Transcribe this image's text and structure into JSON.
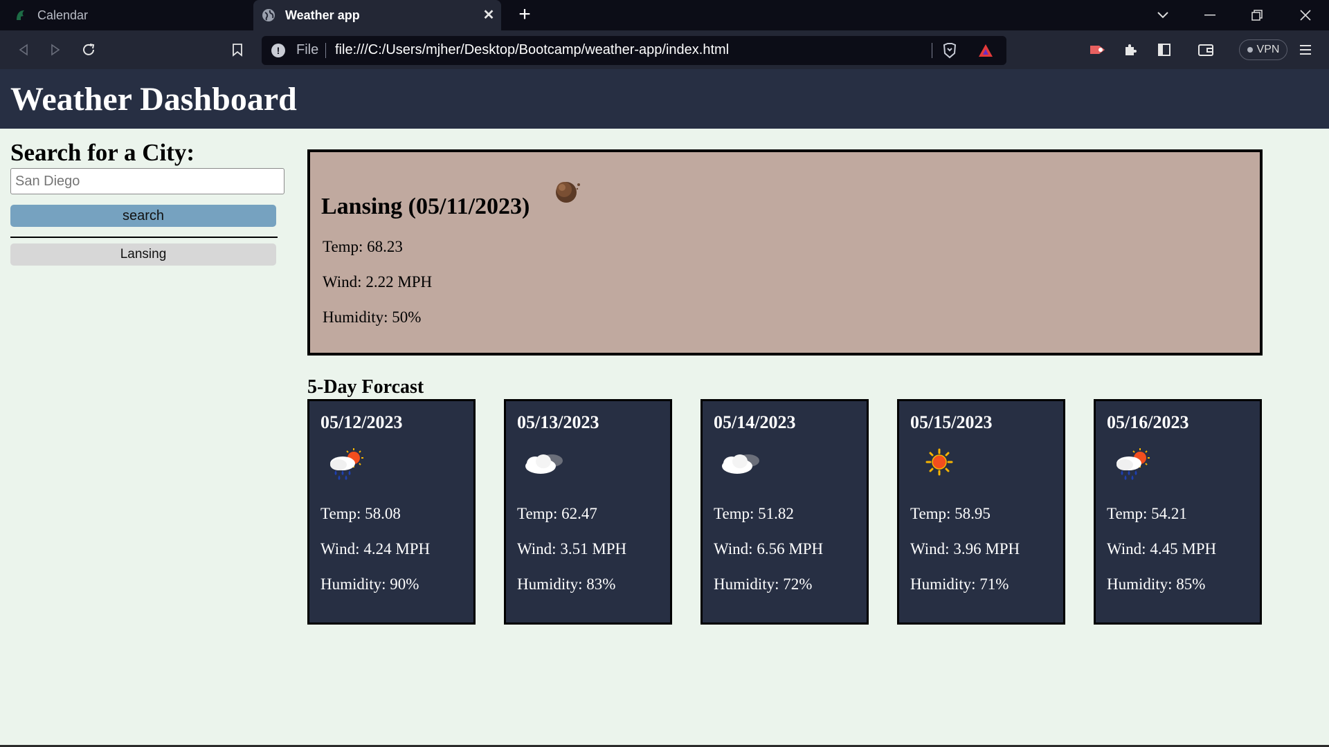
{
  "browser": {
    "tabs": [
      {
        "title": "Calendar",
        "icon": "spartan-helmet-icon"
      },
      {
        "title": "Weather app",
        "icon": "globe-icon"
      }
    ],
    "address_scheme": "File",
    "url": "file:///C:/Users/mjher/Desktop/Bootcamp/weather-app/index.html",
    "vpn_label": "VPN"
  },
  "page": {
    "title": "Weather Dashboard",
    "search_heading": "Search for a City:",
    "search_placeholder": "San Diego",
    "search_button": "search",
    "history": [
      "Lansing"
    ]
  },
  "current": {
    "title": "Lansing (05/11/2023)",
    "icon": "moon-night-icon",
    "temp": "Temp: 68.23",
    "wind": "Wind: 2.22 MPH",
    "humidity": "Humidity: 50%"
  },
  "forecast_heading": "5-Day Forcast",
  "forecast": [
    {
      "date": "05/12/2023",
      "icon": "rain-sun-icon",
      "temp": "Temp: 58.08",
      "wind": "Wind: 4.24 MPH",
      "humidity": "Humidity: 90%"
    },
    {
      "date": "05/13/2023",
      "icon": "cloud-icon",
      "temp": "Temp: 62.47",
      "wind": "Wind: 3.51 MPH",
      "humidity": "Humidity: 83%"
    },
    {
      "date": "05/14/2023",
      "icon": "cloud-icon",
      "temp": "Temp: 51.82",
      "wind": "Wind: 6.56 MPH",
      "humidity": "Humidity: 72%"
    },
    {
      "date": "05/15/2023",
      "icon": "sun-icon",
      "temp": "Temp: 58.95",
      "wind": "Wind: 3.96 MPH",
      "humidity": "Humidity: 71%"
    },
    {
      "date": "05/16/2023",
      "icon": "rain-sun-icon",
      "temp": "Temp: 54.21",
      "wind": "Wind: 4.45 MPH",
      "humidity": "Humidity: 85%"
    }
  ]
}
